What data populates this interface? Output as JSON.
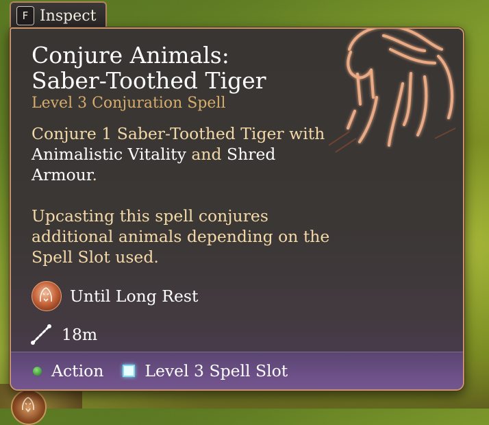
{
  "inspect_tab": {
    "key": "F",
    "label": "Inspect"
  },
  "spell": {
    "title_line1": "Conjure Animals:",
    "title_line2": "Saber-Toothed Tiger",
    "subtitle": "Level 3 Conjuration Spell",
    "description": {
      "part1": "Conjure 1 Saber-Toothed Tiger with ",
      "highlight1": "Animalistic Vitality",
      "part2": " and ",
      "highlight2": "Shred Armour",
      "part3": "."
    },
    "upcast_text": "Upcasting this spell conjures additional animals depending on the Spell Slot used.",
    "duration": "Until Long Rest",
    "range": "18m",
    "footer": {
      "action_label": "Action",
      "slot_label": "Level 3 Spell Slot"
    },
    "icons": {
      "spell_art": "saber-tooth-tiger-icon",
      "duration": "tiger-duration-icon",
      "range": "range-icon",
      "action": "action-dot-icon",
      "slot": "spell-slot-icon"
    },
    "colors": {
      "border": "#c69468",
      "subtitle": "#d7ad6b",
      "description": "#f4d9a8",
      "action": "#3e9a35",
      "slot": "#7fd8ef"
    }
  }
}
